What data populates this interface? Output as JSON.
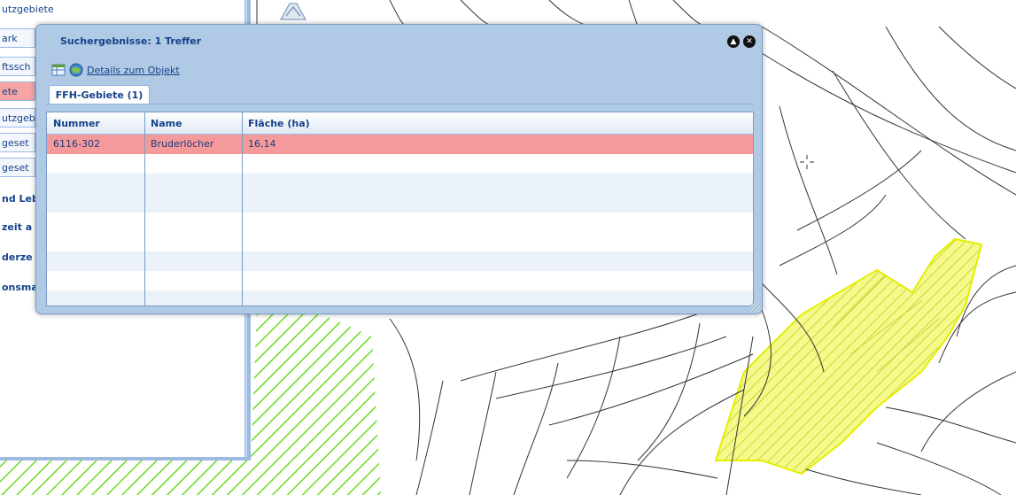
{
  "layer_panel": {
    "items": [
      {
        "label": "utzgebiete",
        "style": "plain"
      },
      {
        "label": "ark",
        "style": "boxed"
      },
      {
        "label": "ftssch",
        "style": "boxed"
      },
      {
        "label": "ete",
        "style": "active"
      },
      {
        "label": "utzgeb",
        "style": "boxed"
      },
      {
        "label": "geset",
        "style": "boxed"
      },
      {
        "label": "geset",
        "style": "boxed"
      },
      {
        "label": "nd Leb",
        "style": "bold"
      },
      {
        "label": "zeit a",
        "style": "bold"
      },
      {
        "label": "derze",
        "style": "bold"
      },
      {
        "label": "onsma",
        "style": "bold"
      }
    ]
  },
  "dialog": {
    "title": "Suchergebnisse: 1 Treffer",
    "details_link": "Details zum Objekt",
    "tab_label": "FFH-Gebiete (1)",
    "columns": [
      "Nummer",
      "Name",
      "Fläche (ha)"
    ],
    "rows": [
      {
        "nummer": "6116-302",
        "name": "Bruderlöcher",
        "flaeche": "16,14",
        "selected": true
      }
    ],
    "icons": [
      "table-icon",
      "globe-icon",
      "collapse-icon",
      "close-icon"
    ]
  },
  "colors": {
    "selected_row": "#f59a9a",
    "dialog_frame": "#b0c9e4",
    "ffh_area_fill": "#eef55a",
    "hatch_green": "#66dd22"
  }
}
